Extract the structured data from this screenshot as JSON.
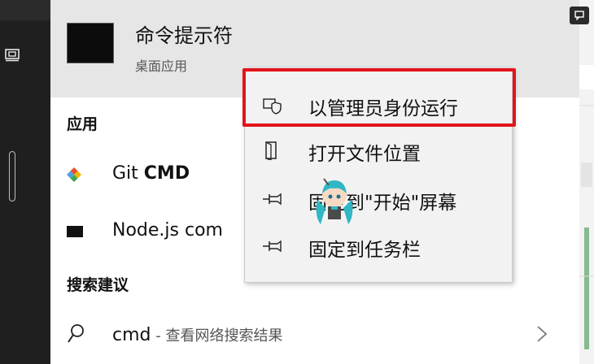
{
  "best_match": {
    "title": "命令提示符",
    "subtitle": "桌面应用"
  },
  "sections": {
    "apps_label": "应用",
    "suggestions_label": "搜索建议"
  },
  "apps": [
    {
      "name_prefix": "Git ",
      "name_bold": "CMD",
      "icon": "git-icon"
    },
    {
      "name_prefix": "Node.js com",
      "name_bold": "",
      "icon": "console-icon"
    }
  ],
  "suggestion": {
    "query": "cmd",
    "suffix": " - 查看网络搜索结果",
    "icon": "search-icon"
  },
  "context_menu": {
    "items": [
      {
        "label": "以管理员身份运行",
        "icon": "shield-icon"
      },
      {
        "label": "打开文件位置",
        "icon": "file-icon"
      },
      {
        "label": "固定到\"开始\"屏幕",
        "icon": "pin-icon"
      },
      {
        "label": "固定到任务栏",
        "icon": "pin-icon"
      }
    ]
  },
  "colors": {
    "highlight": "#e3141b",
    "best_match_bg": "#e6e6e6",
    "menu_bg": "#f2f2f2"
  }
}
